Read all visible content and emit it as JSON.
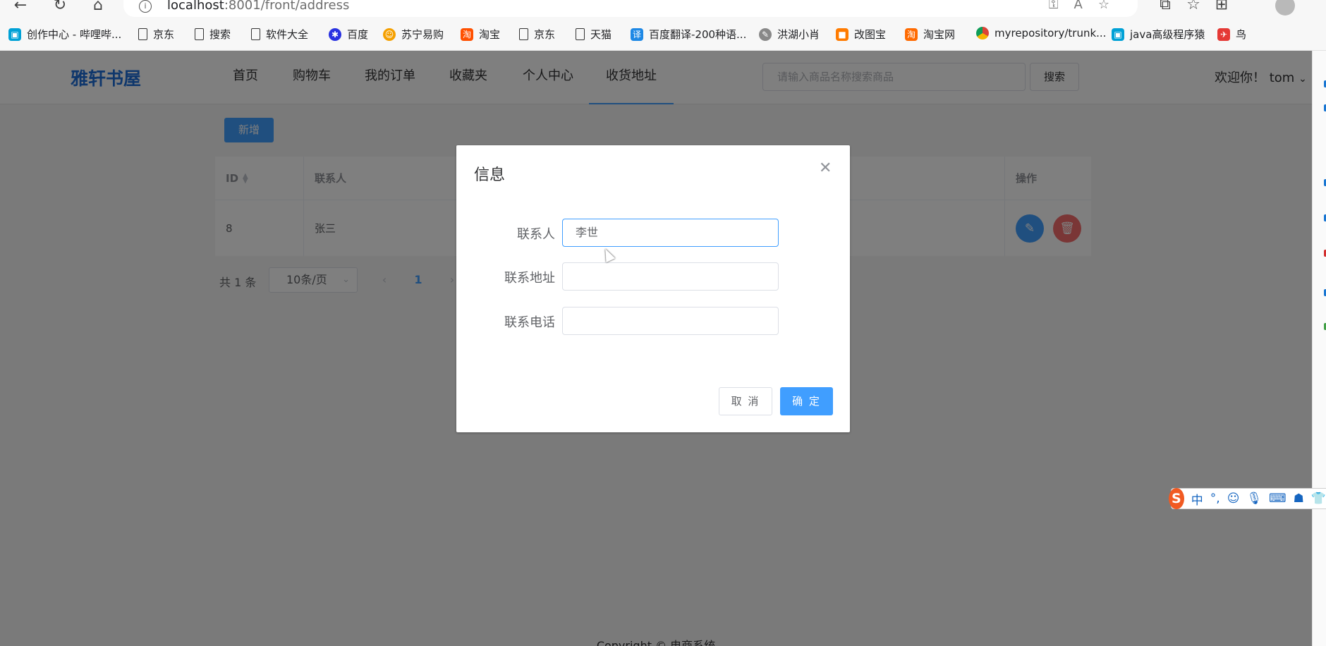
{
  "browser": {
    "url_host": "localhost",
    "url_rest": ":8001/front/address",
    "bookmarks": [
      {
        "label": "创作中心 - 哔哩哔...",
        "icon": "bilibili-icon"
      },
      {
        "label": "京东",
        "icon": "page-icon"
      },
      {
        "label": "搜索",
        "icon": "page-icon"
      },
      {
        "label": "软件大全",
        "icon": "page-icon"
      },
      {
        "label": "百度",
        "icon": "baidu-icon"
      },
      {
        "label": "苏宁易购",
        "icon": "suning-icon"
      },
      {
        "label": "淘宝",
        "icon": "taobao-icon"
      },
      {
        "label": "京东",
        "icon": "page-icon"
      },
      {
        "label": "天猫",
        "icon": "page-icon"
      },
      {
        "label": "百度翻译-200种语...",
        "icon": "translate-icon"
      },
      {
        "label": "洪湖小肖",
        "icon": "hh-icon"
      },
      {
        "label": "改图宝",
        "icon": "gaitubao-icon"
      },
      {
        "label": "淘宝网",
        "icon": "taobao-icon"
      },
      {
        "label": "myrepository/trunk...",
        "icon": "chrome-icon"
      },
      {
        "label": "java高级程序猿",
        "icon": "bilibili-icon"
      },
      {
        "label": "鸟",
        "icon": "bird-icon"
      }
    ]
  },
  "header": {
    "logo": "雅轩书屋",
    "menu": [
      "首页",
      "购物车",
      "我的订单",
      "收藏夹",
      "个人中心",
      "收货地址"
    ],
    "active_menu": "收货地址",
    "search_placeholder": "请输入商品名称搜索商品",
    "search_button": "搜索",
    "welcome": "欢迎你！ tom"
  },
  "toolbar": {
    "add_label": "新增"
  },
  "table": {
    "columns": [
      "ID",
      "联系人",
      "操作"
    ],
    "rows": [
      {
        "id": "8",
        "contact": "张三"
      }
    ]
  },
  "pagination": {
    "total": "共 1 条",
    "page_size": "10条/页",
    "current_page": "1"
  },
  "footer": {
    "copyright": "Copyright © 电商系统"
  },
  "dialog": {
    "title": "信息",
    "fields": [
      {
        "label": "联系人",
        "value": "李世"
      },
      {
        "label": "联系地址",
        "value": ""
      },
      {
        "label": "联系电话",
        "value": ""
      }
    ],
    "cancel_label": "取 消",
    "ok_label": "确 定"
  },
  "ime": {
    "logo": "S",
    "mode": "中",
    "punct": "°,"
  },
  "colors": {
    "primary": "#409eff",
    "danger": "#f56c6c",
    "logo": "#1e6fd9"
  }
}
